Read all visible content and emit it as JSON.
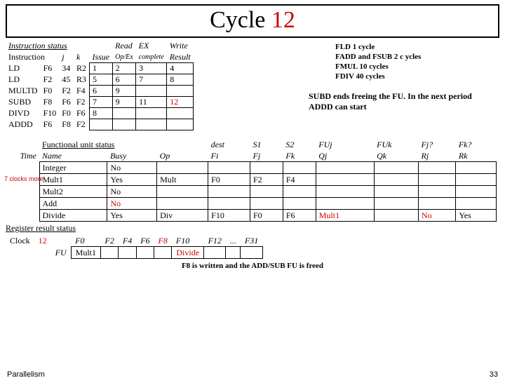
{
  "title": {
    "part1": "Cycle ",
    "part2": "12"
  },
  "instr": {
    "header_left": "Instruction status",
    "col_read": "Read",
    "col_ex": "EX",
    "col_write": "Write",
    "col_instr": "Instruction",
    "col_j": "j",
    "col_k": "k",
    "col_issue": "Issue",
    "col_opex": "Op/Ex",
    "col_complete": "complete",
    "col_result": "Result",
    "rows": [
      {
        "i": "LD",
        "d": "F6",
        "j": "34",
        "k": "R2",
        "is": "1",
        "rd": "2",
        "ex": "3",
        "wr": "4"
      },
      {
        "i": "LD",
        "d": "F2",
        "j": "45",
        "k": "R3",
        "is": "5",
        "rd": "6",
        "ex": "7",
        "wr": "8"
      },
      {
        "i": "MULTD",
        "d": "F0",
        "j": "F2",
        "k": "F4",
        "is": "6",
        "rd": "9",
        "ex": "",
        "wr": ""
      },
      {
        "i": "SUBD",
        "d": "F8",
        "j": "F6",
        "k": "F2",
        "is": "7",
        "rd": "9",
        "ex": "11",
        "wr": "12"
      },
      {
        "i": "DIVD",
        "d": "F10",
        "j": "F0",
        "k": "F6",
        "is": "8",
        "rd": "",
        "ex": "",
        "wr": ""
      },
      {
        "i": "ADDD",
        "d": "F6",
        "j": "F8",
        "k": "F2",
        "is": "",
        "rd": "",
        "ex": "",
        "wr": ""
      }
    ]
  },
  "latency": {
    "l1": "FLD    1 cycle",
    "l2": "FADD and FSUB  2 c ycles",
    "l3": "FMUL 10 cycles",
    "l4": "FDIV   40 cycles"
  },
  "annotation": "SUBD ends freeing the FU. In the next period ADDD can start",
  "fu": {
    "header": "Functional unit status",
    "time": "Time",
    "name": "Name",
    "busy": "Busy",
    "op": "Op",
    "dest": "dest",
    "fi": "Fi",
    "s1": "S1",
    "fj": "Fj",
    "s2": "S2",
    "fk": "Fk",
    "fuj": "FUj",
    "qj": "Qj",
    "fuk": "FUk",
    "qk": "Qk",
    "fjq": "Fj?",
    "rj": "Rj",
    "fkq": "Fk?",
    "rk": "Rk",
    "clocks_more": "7  clocks more",
    "rows": [
      {
        "name": "Integer",
        "busy": "No",
        "op": "",
        "fi": "",
        "fj": "",
        "fk": "",
        "qj": "",
        "qk": "",
        "rj": "",
        "rk": ""
      },
      {
        "name": "Mult1",
        "busy": "Yes",
        "op": "Mult",
        "fi": "F0",
        "fj": "F2",
        "fk": "F4",
        "qj": "",
        "qk": "",
        "rj": "",
        "rk": ""
      },
      {
        "name": "Mult2",
        "busy": "No",
        "op": "",
        "fi": "",
        "fj": "",
        "fk": "",
        "qj": "",
        "qk": "",
        "rj": "",
        "rk": ""
      },
      {
        "name": "Add",
        "busy": "No",
        "op": "",
        "fi": "",
        "fj": "",
        "fk": "",
        "qj": "",
        "qk": "",
        "rj": "",
        "rk": ""
      },
      {
        "name": "Divide",
        "busy": "Yes",
        "op": "Div",
        "fi": "F10",
        "fj": "F0",
        "fk": "F6",
        "qj": "Mult1",
        "qk": "",
        "rj": "No",
        "rk": "Yes"
      }
    ]
  },
  "reg": {
    "header": "Register result status",
    "clock": "Clock",
    "cycle": "12",
    "fu": "FU",
    "cols": [
      "F0",
      "F2",
      "F4",
      "F6",
      "F8",
      "F10",
      "F12",
      "...",
      "F31"
    ],
    "vals": [
      "Mult1",
      "",
      "",
      "",
      "",
      "Divide",
      "",
      "",
      ""
    ]
  },
  "footnote": "F8 is written and the ADD/SUB FU is freed",
  "footer": {
    "left": "Parallelism",
    "right": "33"
  }
}
